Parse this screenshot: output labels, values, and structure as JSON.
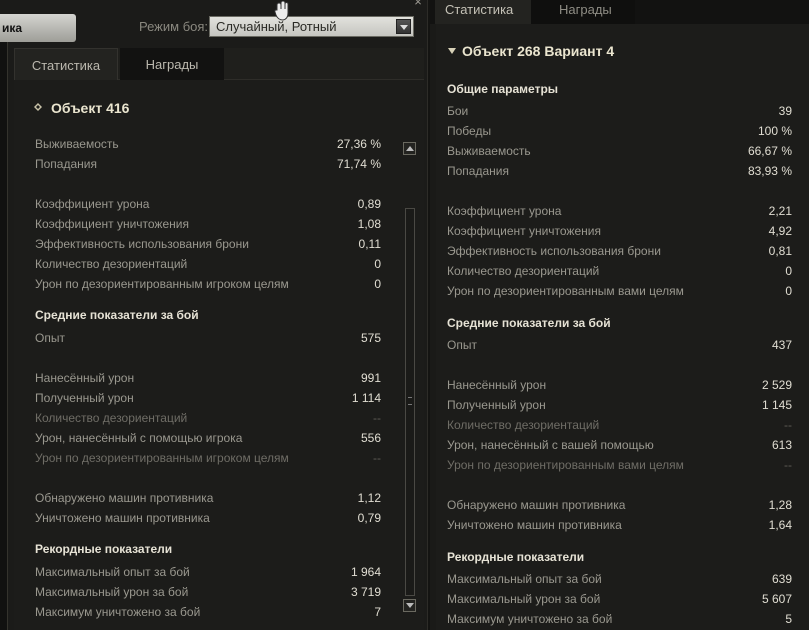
{
  "left_panel": {
    "top_button": "ика",
    "close_symbol": "×",
    "battle_mode_label": "Режим боя:",
    "battle_mode_value": "Случайный, Ротный",
    "tabs": [
      "Статистика",
      "Награды"
    ],
    "vehicle_title": "Объект 416",
    "group1": [
      {
        "label": "Выживаемость",
        "value": "27,36 %"
      },
      {
        "label": "Попадания",
        "value": "71,74 %"
      }
    ],
    "group2": [
      {
        "label": "Коэффициент урона",
        "value": "0,89"
      },
      {
        "label": "Коэффициент уничтожения",
        "value": "1,08"
      },
      {
        "label": "Эффективность использования брони",
        "value": "0,11"
      },
      {
        "label": "Количество дезориентаций",
        "value": "0"
      },
      {
        "label": "Урон по дезориентированным игроком целям",
        "value": "0"
      }
    ],
    "avg_section": "Средние показатели за бой",
    "group3": [
      {
        "label": "Опыт",
        "value": "575"
      }
    ],
    "group4": [
      {
        "label": "Нанесённый урон",
        "value": "991"
      },
      {
        "label": "Полученный урон",
        "value": "1 114"
      },
      {
        "label": "Количество дезориентаций",
        "value": "--"
      },
      {
        "label": "Урон, нанесённый с помощью игрока",
        "value": "556"
      },
      {
        "label": "Урон по дезориентированным игроком целям",
        "value": "--"
      }
    ],
    "group5": [
      {
        "label": "Обнаружено машин противника",
        "value": "1,12"
      },
      {
        "label": "Уничтожено машин противника",
        "value": "0,79"
      }
    ],
    "record_section": "Рекордные показатели",
    "group6": [
      {
        "label": "Максимальный опыт за бой",
        "value": "1 964"
      },
      {
        "label": "Максимальный урон за бой",
        "value": "3 719"
      },
      {
        "label": "Максимум уничтожено за бой",
        "value": "7"
      }
    ]
  },
  "right_panel": {
    "tabs": [
      "Статистика",
      "Награды"
    ],
    "vehicle_title": "Объект 268 Вариант 4",
    "general_section": "Общие параметры",
    "group1": [
      {
        "label": "Бои",
        "value": "39"
      },
      {
        "label": "Победы",
        "value": "100 %"
      },
      {
        "label": "Выживаемость",
        "value": "66,67 %"
      },
      {
        "label": "Попадания",
        "value": "83,93 %"
      }
    ],
    "group2": [
      {
        "label": "Коэффициент урона",
        "value": "2,21"
      },
      {
        "label": "Коэффициент уничтожения",
        "value": "4,92"
      },
      {
        "label": "Эффективность использования брони",
        "value": "0,81"
      },
      {
        "label": "Количество дезориентаций",
        "value": "0"
      },
      {
        "label": "Урон по дезориентированным вами целям",
        "value": "0"
      }
    ],
    "avg_section": "Средние показатели за бой",
    "group3": [
      {
        "label": "Опыт",
        "value": "437"
      }
    ],
    "group4": [
      {
        "label": "Нанесённый урон",
        "value": "2 529"
      },
      {
        "label": "Полученный урон",
        "value": "1 145"
      },
      {
        "label": "Количество дезориентаций",
        "value": "--"
      },
      {
        "label": "Урон, нанесённый с вашей помощью",
        "value": "613"
      },
      {
        "label": "Урон по дезориентированным вами целям",
        "value": "--"
      }
    ],
    "group5": [
      {
        "label": "Обнаружено машин противника",
        "value": "1,28"
      },
      {
        "label": "Уничтожено машин противника",
        "value": "1,64"
      }
    ],
    "record_section": "Рекордные показатели",
    "group6": [
      {
        "label": "Максимальный опыт за бой",
        "value": "639"
      },
      {
        "label": "Максимальный урон за бой",
        "value": "5 607"
      },
      {
        "label": "Максимум уничтожено за бой",
        "value": "5"
      }
    ]
  }
}
